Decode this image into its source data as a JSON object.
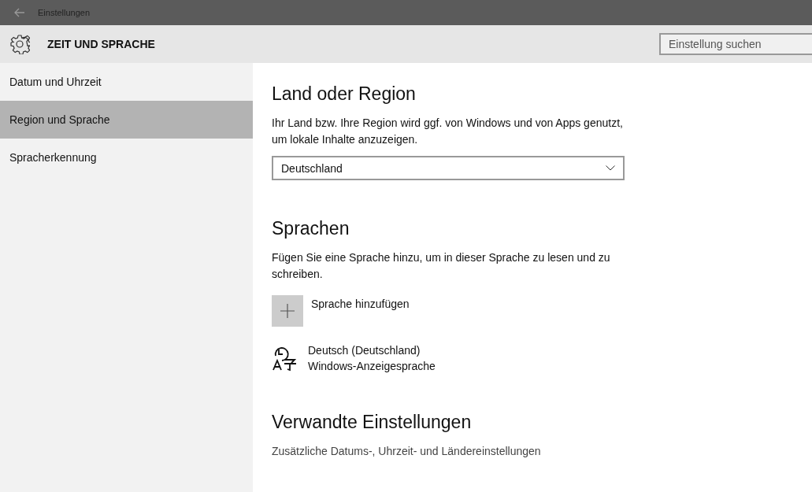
{
  "window": {
    "title": "Einstellungen"
  },
  "header": {
    "title": "ZEIT UND SPRACHE",
    "search": {
      "placeholder": "Einstellung suchen"
    }
  },
  "sidebar": {
    "items": [
      {
        "label": "Datum und Uhrzeit",
        "selected": false
      },
      {
        "label": "Region und Sprache",
        "selected": true
      },
      {
        "label": "Spracherkennung",
        "selected": false
      }
    ]
  },
  "region": {
    "heading": "Land oder Region",
    "description": "Ihr Land bzw. Ihre Region wird ggf. von Windows und von Apps genutzt, um lokale Inhalte anzuzeigen.",
    "dropdown": "Deutschland"
  },
  "languages": {
    "heading": "Sprachen",
    "description": "Fügen Sie eine Sprache hinzu, um in dieser Sprache zu lesen und zu schreiben.",
    "add_button": "Sprache hinzufügen",
    "items": [
      {
        "name": "Deutsch (Deutschland)",
        "detail": "Windows-Anzeigesprache"
      }
    ]
  },
  "related": {
    "heading": "Verwandte Einstellungen",
    "links": [
      "Zusätzliche Datums-, Uhrzeit- und Ländereinstellungen"
    ]
  }
}
